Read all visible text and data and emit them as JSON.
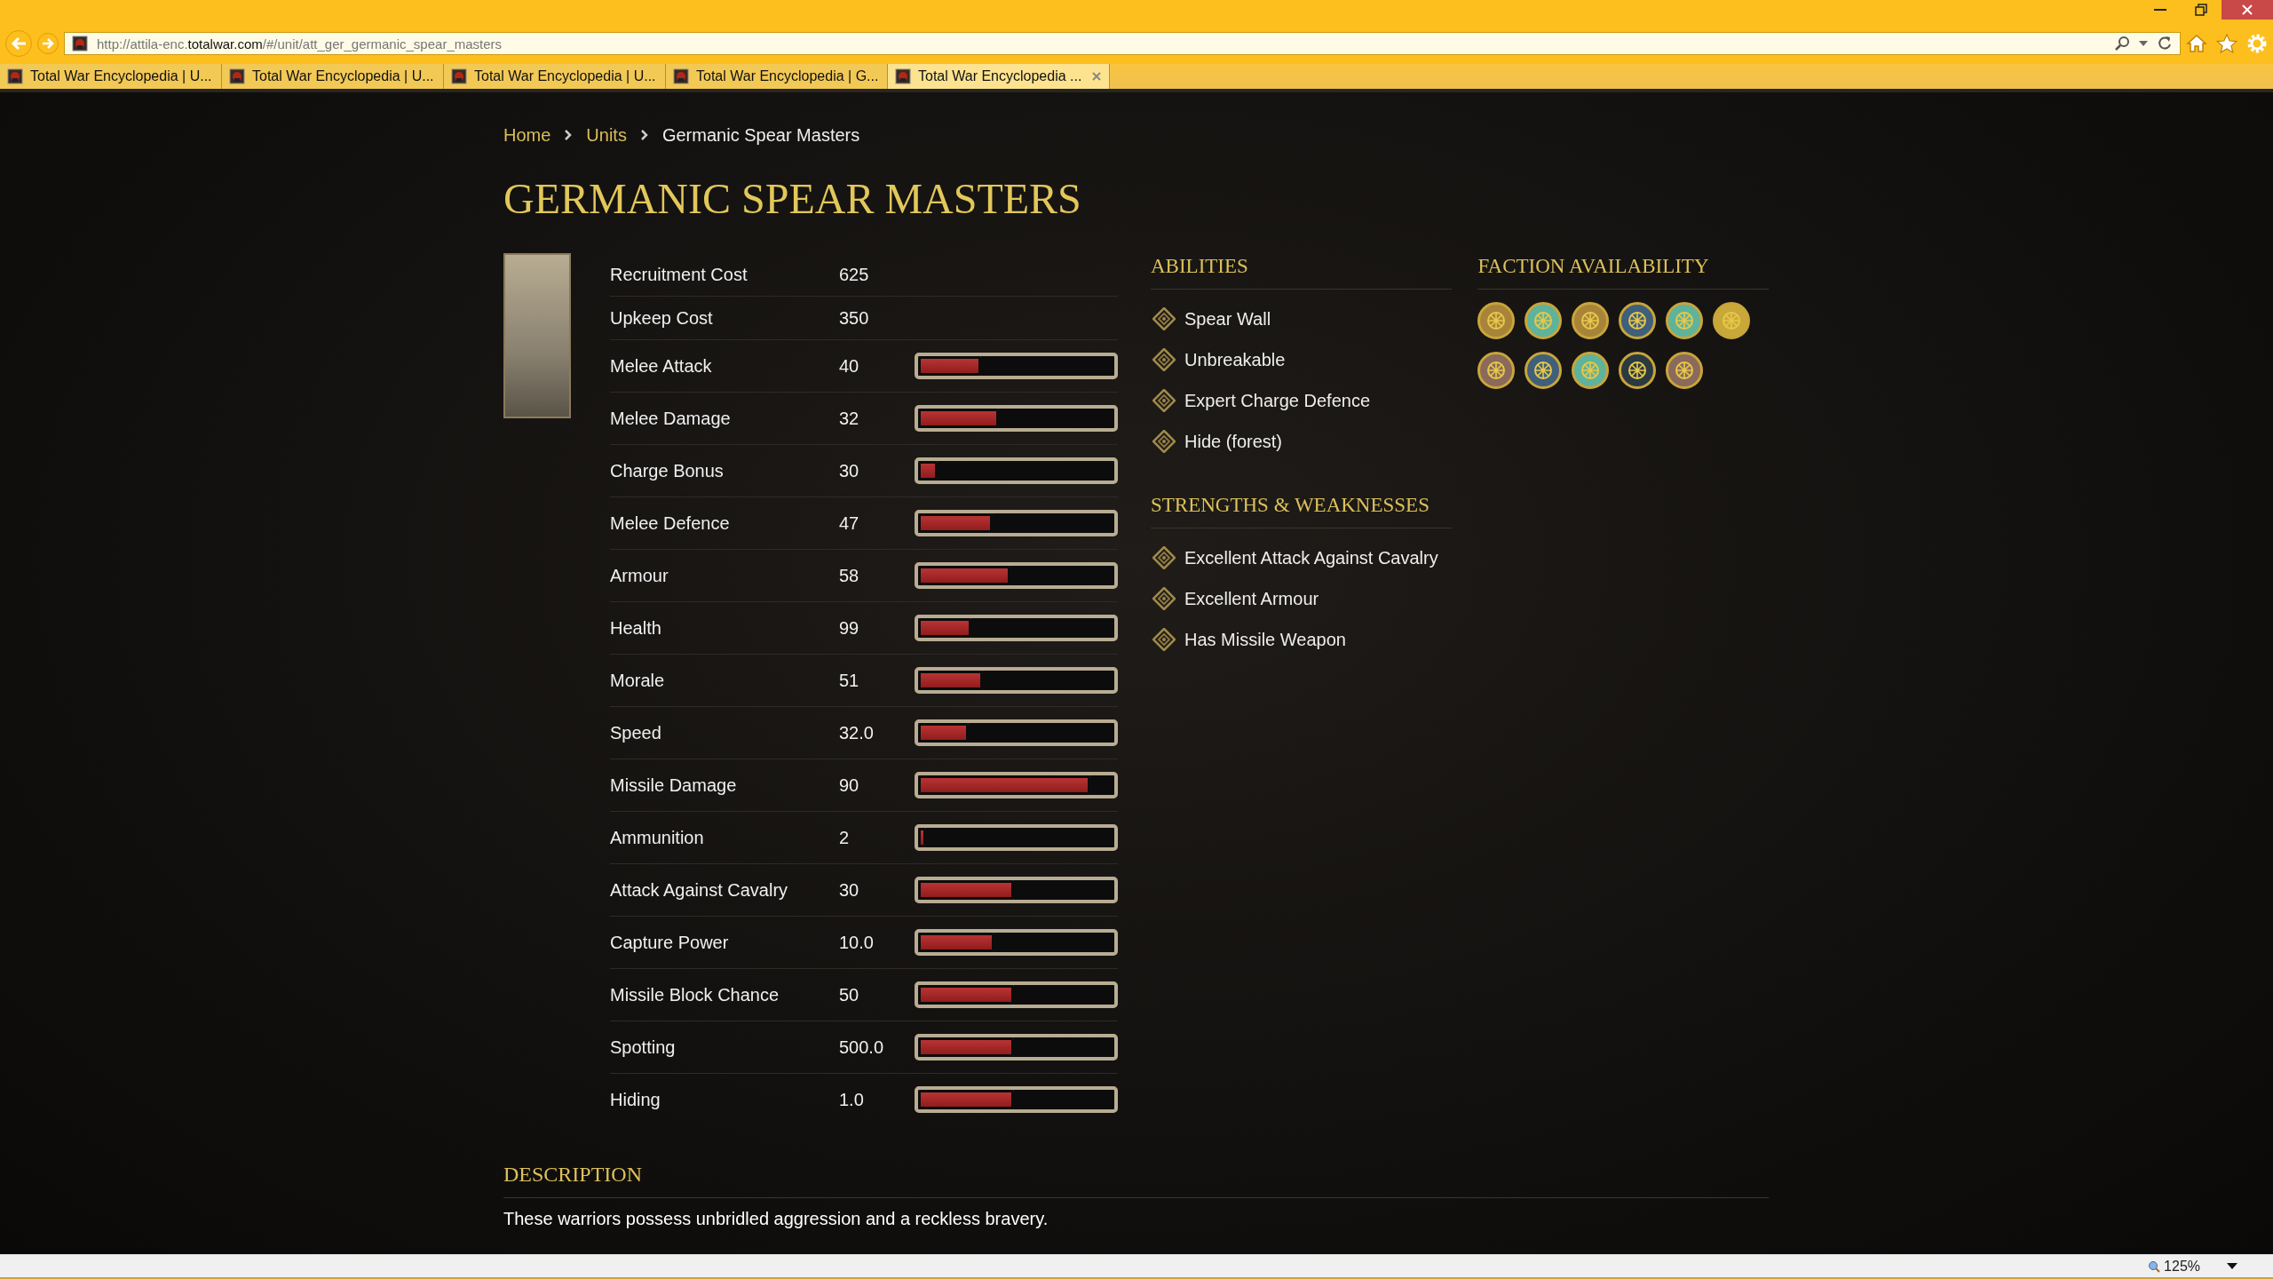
{
  "browser": {
    "url": {
      "host_prefix": "http://attila-enc.",
      "domain": "totalwar.com",
      "path": "/#/unit/att_ger_germanic_spear_masters"
    },
    "tabs": [
      {
        "title": "Total War Encyclopedia | U...",
        "selected": false
      },
      {
        "title": "Total War Encyclopedia | U...",
        "selected": false
      },
      {
        "title": "Total War Encyclopedia | U...",
        "selected": false
      },
      {
        "title": "Total War Encyclopedia | G...",
        "selected": false
      },
      {
        "title": "Total War Encyclopedia ...",
        "selected": true
      }
    ]
  },
  "breadcrumb": [
    {
      "label": "Home",
      "kind": "link"
    },
    {
      "label": "Units",
      "kind": "link"
    },
    {
      "label": "Germanic Spear Masters",
      "kind": "current"
    }
  ],
  "title": "GERMANIC SPEAR MASTERS",
  "stats": [
    {
      "kind": "plain",
      "label": "Recruitment Cost",
      "value": "625"
    },
    {
      "kind": "plain",
      "label": "Upkeep Cost",
      "value": "350"
    },
    {
      "kind": "bar",
      "label": "Melee Attack",
      "value": "40",
      "level": 0.32
    },
    {
      "kind": "bar",
      "label": "Melee Damage",
      "value": "32",
      "level": 0.41
    },
    {
      "kind": "bar",
      "label": "Charge Bonus",
      "value": "30",
      "level": 0.1
    },
    {
      "kind": "bar",
      "label": "Melee Defence",
      "value": "47",
      "level": 0.38
    },
    {
      "kind": "bar",
      "label": "Armour",
      "value": "58",
      "level": 0.47
    },
    {
      "kind": "bar",
      "label": "Health",
      "value": "99",
      "level": 0.27
    },
    {
      "kind": "bar",
      "label": "Morale",
      "value": "51",
      "level": 0.33
    },
    {
      "kind": "bar",
      "label": "Speed",
      "value": "32.0",
      "level": 0.26
    },
    {
      "kind": "bar",
      "label": "Missile Damage",
      "value": "90",
      "level": 0.88
    },
    {
      "kind": "bar",
      "label": "Ammunition",
      "value": "2",
      "level": 0.04
    },
    {
      "kind": "bar",
      "label": "Attack Against Cavalry",
      "value": "30",
      "level": 0.49
    },
    {
      "kind": "bar",
      "label": "Capture Power",
      "value": "10.0",
      "level": 0.39
    },
    {
      "kind": "bar",
      "label": "Missile Block Chance",
      "value": "50",
      "level": 0.49
    },
    {
      "kind": "bar",
      "label": "Spotting",
      "value": "500.0",
      "level": 0.49
    },
    {
      "kind": "bar",
      "label": "Hiding",
      "value": "1.0",
      "level": 0.49
    }
  ],
  "abilities": {
    "heading": "ABILITIES",
    "items": [
      "Spear Wall",
      "Unbreakable",
      "Expert Charge Defence",
      "Hide (forest)"
    ]
  },
  "strengths": {
    "heading": "STRENGTHS & WEAKNESSES",
    "items": [
      "Excellent Attack Against Cavalry",
      "Excellent Armour",
      "Has Missile Weapon"
    ]
  },
  "factions": {
    "heading": "FACTION AVAILABILITY",
    "items": [
      {
        "color": "#a8843a"
      },
      {
        "color": "#5fb39a"
      },
      {
        "color": "#a8843a"
      },
      {
        "color": "#3f5f7a"
      },
      {
        "color": "#5fb39a"
      },
      {
        "color": "#c9a83a"
      },
      {
        "color": "#8a6a5a"
      },
      {
        "color": "#3f5f7a"
      },
      {
        "color": "#5fb39a"
      },
      {
        "color": "#2a3a40"
      },
      {
        "color": "#8a6a5a"
      }
    ]
  },
  "description": {
    "heading": "DESCRIPTION",
    "text": "These warriors possess unbridled aggression and a reckless bravery."
  },
  "status_bar": {
    "zoom": "125%"
  }
}
